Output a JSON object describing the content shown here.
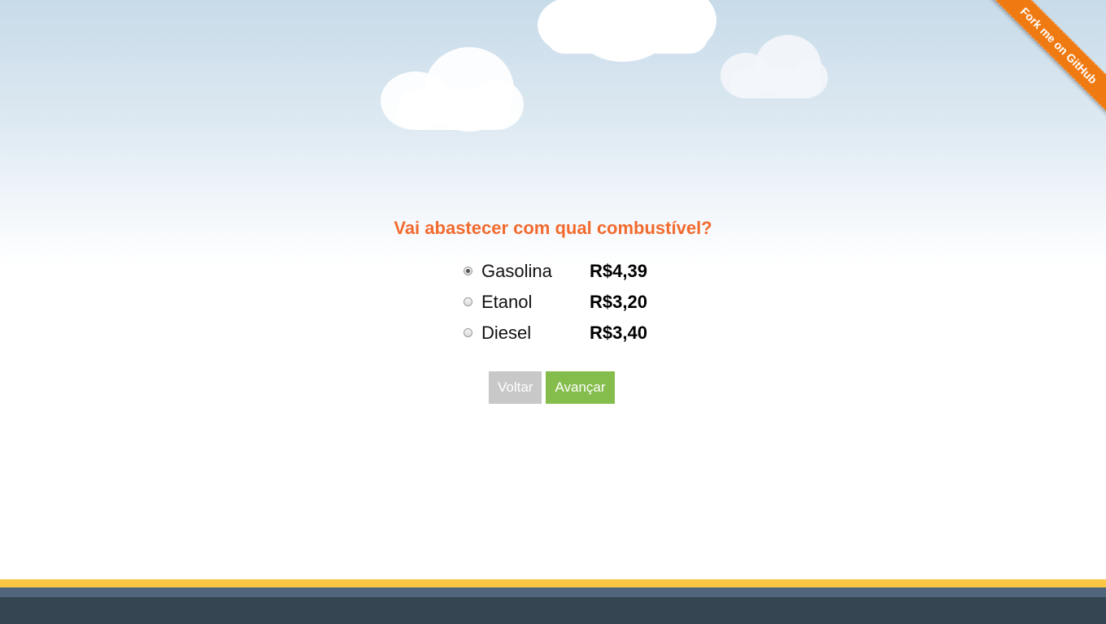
{
  "ribbon": {
    "label": "Fork me on GitHub",
    "color": "#f07a12"
  },
  "question": {
    "text": "Vai abastecer com qual combustível?",
    "color": "#f26a2e"
  },
  "fuels": [
    {
      "name": "Gasolina",
      "price": "R$4,39",
      "selected": true
    },
    {
      "name": "Etanol",
      "price": "R$3,20",
      "selected": false
    },
    {
      "name": "Diesel",
      "price": "R$3,40",
      "selected": false
    }
  ],
  "buttons": {
    "back_label": "Voltar",
    "next_label": "Avançar",
    "back_color": "#c8c8c8",
    "next_color": "#85bd4c"
  },
  "footer": {
    "yellow": "#fbc745",
    "blue": "#50667a",
    "dark": "#354652"
  }
}
